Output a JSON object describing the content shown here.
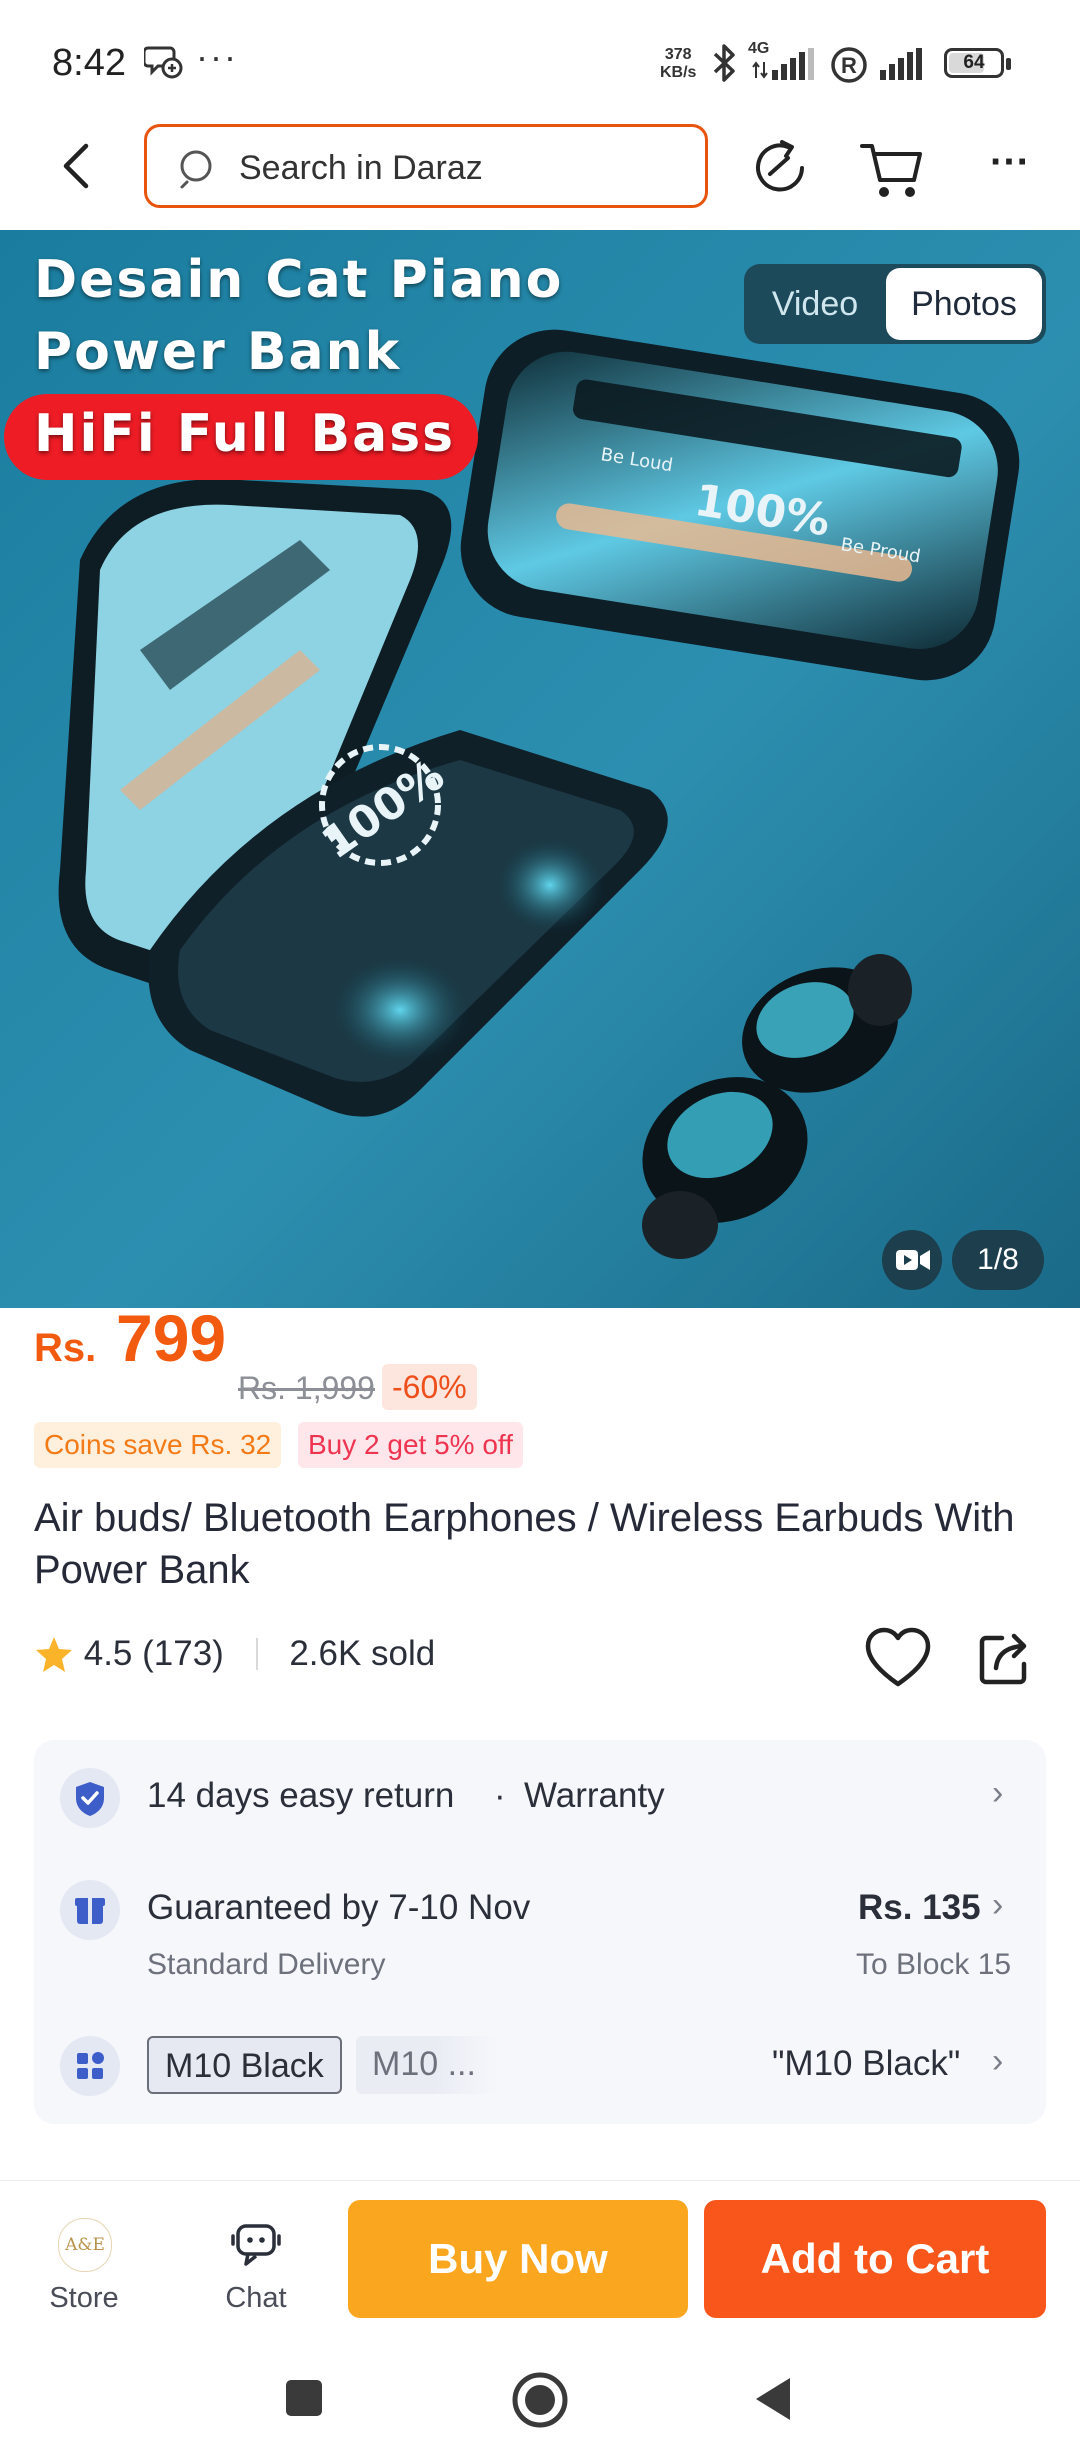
{
  "status_bar": {
    "time": "8:42",
    "more": "···",
    "net_speed_value": "378",
    "net_speed_unit": "KB/s",
    "network": "4G",
    "battery": "64"
  },
  "nav": {
    "search_placeholder": "Search in Daraz",
    "more": "···"
  },
  "hero": {
    "line1": "Desain Cat Piano",
    "line2": "Power Bank",
    "line3": "HiFi Full Bass",
    "tab_video": "Video",
    "tab_photos": "Photos",
    "active_tab": "Photos",
    "counter": "1/8",
    "case_label_left": "Be Loud",
    "case_label_percent": "100%",
    "case_label_right": "Be Proud"
  },
  "price": {
    "currency": "Rs.",
    "current": "799",
    "original": "Rs. 1,999",
    "discount": "-60%",
    "coins_badge": "Coins save Rs. 32",
    "promo_badge": "Buy 2 get 5% off"
  },
  "product": {
    "title": "Air buds/ Bluetooth Earphones / Wireless Earbuds With Power Bank",
    "rating": "4.5",
    "reviews": "(173)",
    "sold": "2.6K sold"
  },
  "info": {
    "return_text": "14 days easy return",
    "dot": "·",
    "warranty_text": "Warranty",
    "delivery_title": "Guaranteed by 7-10 Nov",
    "delivery_type": "Standard Delivery",
    "delivery_price": "Rs. 135",
    "delivery_location": "To Block 15",
    "variant_1": "M10 Black",
    "variant_2": "M10 ...",
    "selected_variant": "\"M10 Black\""
  },
  "bottom": {
    "store_label": "Store",
    "store_logo_text": "A&E",
    "chat_label": "Chat",
    "buy_now": "Buy Now",
    "add_to_cart": "Add to Cart"
  },
  "colors": {
    "brand_orange": "#f15a0f",
    "buy_now": "#fba61f",
    "add_to_cart": "#f8561a",
    "promo_red": "#ee1c25"
  }
}
